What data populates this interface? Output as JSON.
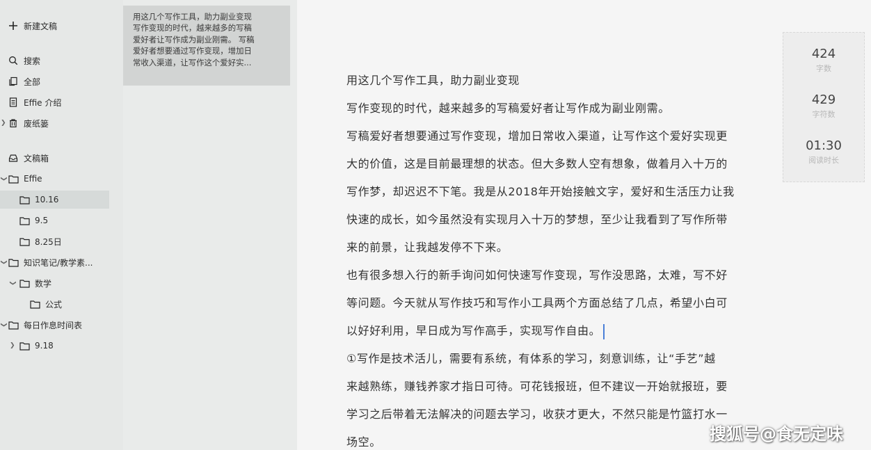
{
  "sidebar": {
    "new_doc": "新建文稿",
    "search": "搜索",
    "all": "全部",
    "effie_intro": "Effie 介绍",
    "trash": "废纸篓",
    "inbox": "文稿箱",
    "folders": {
      "effie": "Effie",
      "f_1016": "10.16",
      "f_95": "9.5",
      "f_825": "8.25日",
      "knowledge": "知识笔记/教学素...",
      "math": "数学",
      "formula": "公式",
      "schedule": "每日作息时间表",
      "f_918": "9.18"
    }
  },
  "list": {
    "card_lines": [
      "用这几个写作工具，助力副业变现",
      "写作变现的时代，越来越多的写稿",
      "爱好者让写作成为副业刚需。 写稿",
      "爱好者想要通过写作变现，增加日",
      "常收入渠道，让写作这个爱好实..."
    ]
  },
  "editor": {
    "lines": [
      "用这几个写作工具，助力副业变现",
      "写作变现的时代，越来越多的写稿爱好者让写作成为副业刚需。",
      "写稿爱好者想要通过写作变现，增加日常收入渠道，让写作这个爱好实现更",
      "大的价值，这是目前最理想的状态。但大多数人空有想象，做着月入十万的",
      "写作梦，却迟迟不下笔。我是从2018年开始接触文字，爱好和生活压力让我",
      "快速的成长，如今虽然没有实现月入十万的梦想，至少让我看到了写作所带",
      "来的前景，让我越发停不下来。",
      "也有很多想入行的新手询问如何快速写作变现，写作没思路，太难，写不好",
      "等问题。今天就从写作技巧和写作小工具两个方面总结了几点，希望小白可",
      "以好好利用，早日成为写作高手，实现写作自由。",
      "①写作是技术活儿，需要有系统，有体系的学习，刻意训练，让“手艺”越",
      "来越熟练，赚钱养家才指日可待。可花钱报班，但不建议一开始就报班，要",
      "学习之后带着无法解决的问题去学习，收获才更大，不然只能是竹篮打水一",
      "场空。"
    ]
  },
  "stats": {
    "words_value": "424",
    "words_label": "字数",
    "chars_value": "429",
    "chars_label": "字符数",
    "time_value": "01:30",
    "time_label": "阅读时长"
  },
  "watermark": "搜狐号@食无定味",
  "colors": {
    "sidebar_bg": "#e6e8e7",
    "selected_bg": "#d6dad9",
    "editor_bg": "#f5f5f5",
    "caret": "#4a7fd8"
  }
}
